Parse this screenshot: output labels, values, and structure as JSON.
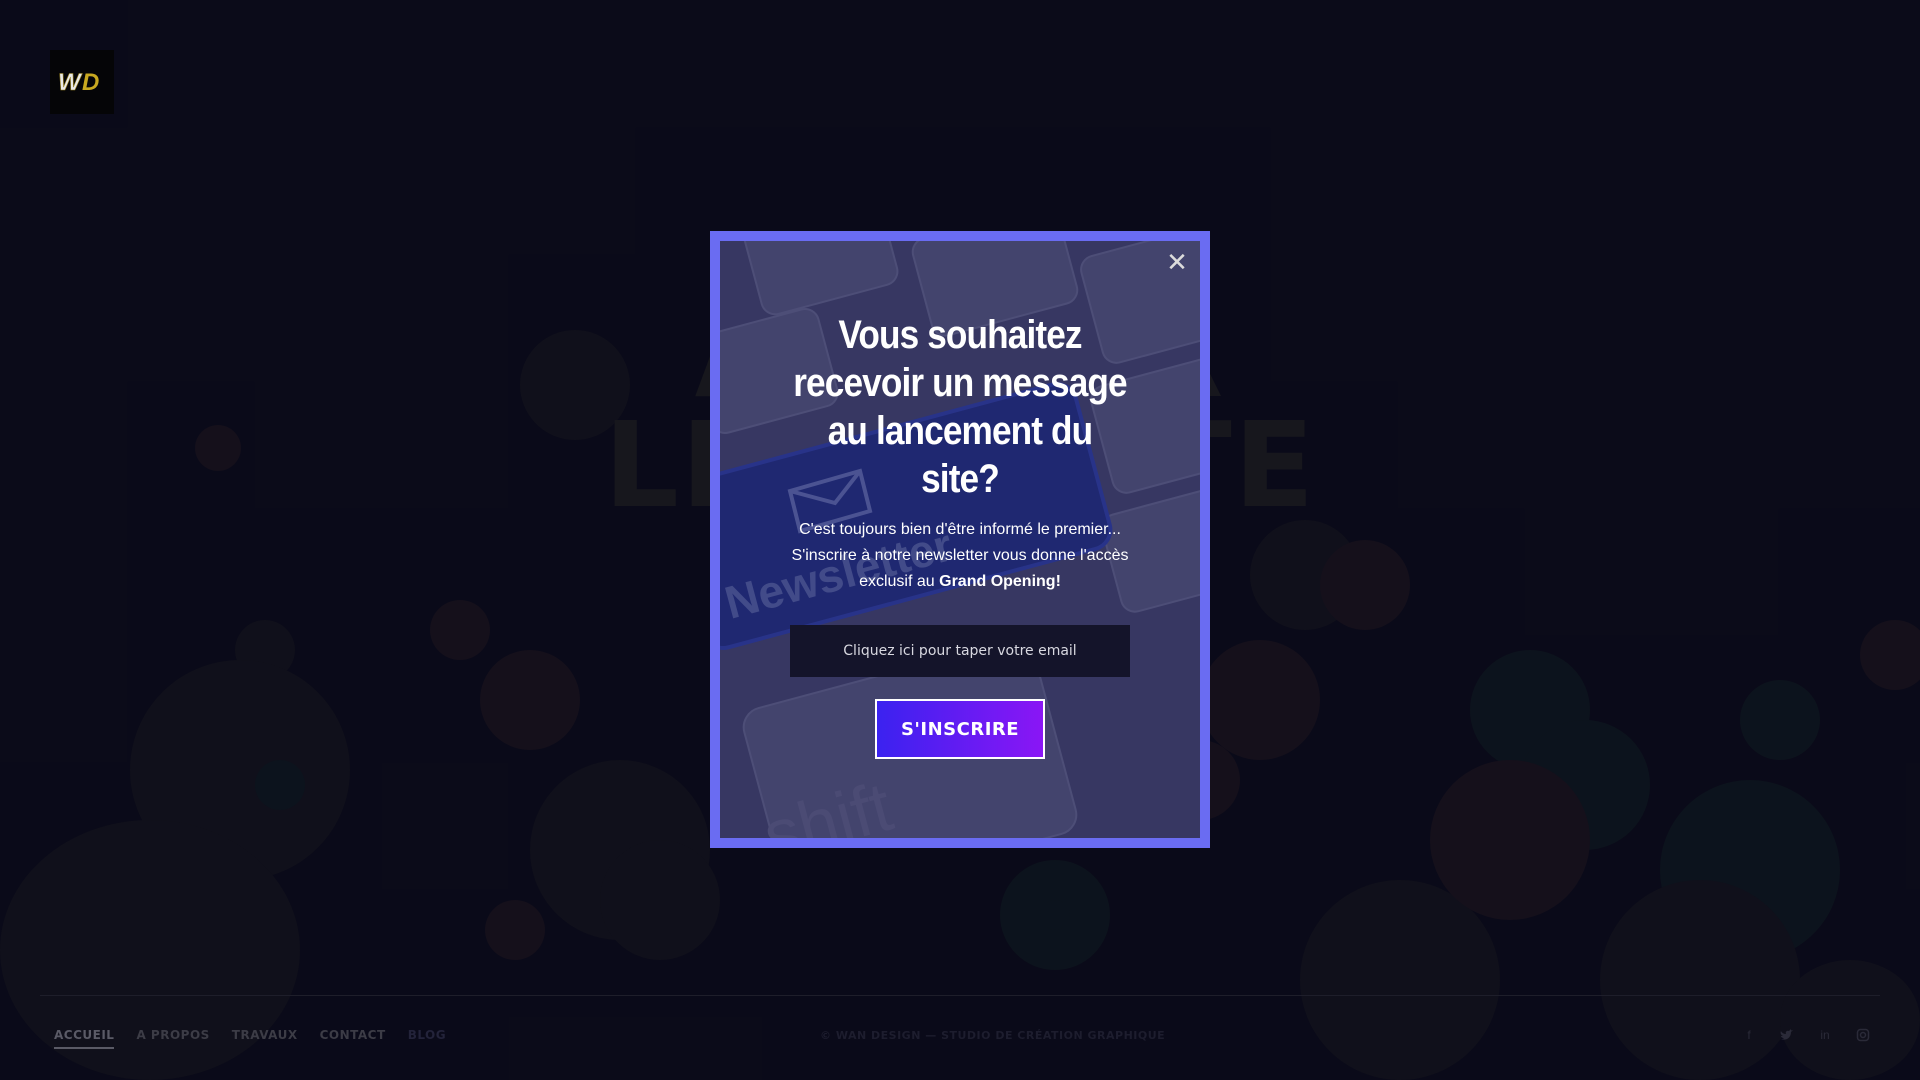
{
  "brand": {
    "logo_text": "WD"
  },
  "background": {
    "headline_line1": "A        R",
    "headline_line2": "LE         TE"
  },
  "popup": {
    "close_label": "✕",
    "title": "Vous souhaitez recevoir un message au lancement du site?",
    "desc_line1": "C'est toujours bien d'être informé le premier...",
    "desc_line2": "S'inscrire à notre newsletter vous donne l'accès",
    "desc_line3_prefix": "exclusif au ",
    "desc_line3_bold": "Grand Opening!",
    "email_placeholder": "Cliquez ici pour taper votre email",
    "submit_label": "S'INSCRIRE",
    "background_image_text": "Newsletter"
  },
  "footer": {
    "nav": [
      {
        "label": "ACCUEIL"
      },
      {
        "label": "A PROPOS"
      },
      {
        "label": "TRAVAUX"
      },
      {
        "label": "CONTACT"
      },
      {
        "label": "BLOG"
      }
    ],
    "copyright": "© WAN DESIGN — STUDIO DE CRÉATION GRAPHIQUE",
    "social": [
      "facebook-icon",
      "twitter-icon",
      "linkedin-icon",
      "instagram-icon"
    ]
  },
  "colors": {
    "popup_border": "#6a6cf2",
    "button_gradient_start": "#3b22f0",
    "button_gradient_end": "#8a16f5",
    "page_bg": "#0c0c1c"
  }
}
